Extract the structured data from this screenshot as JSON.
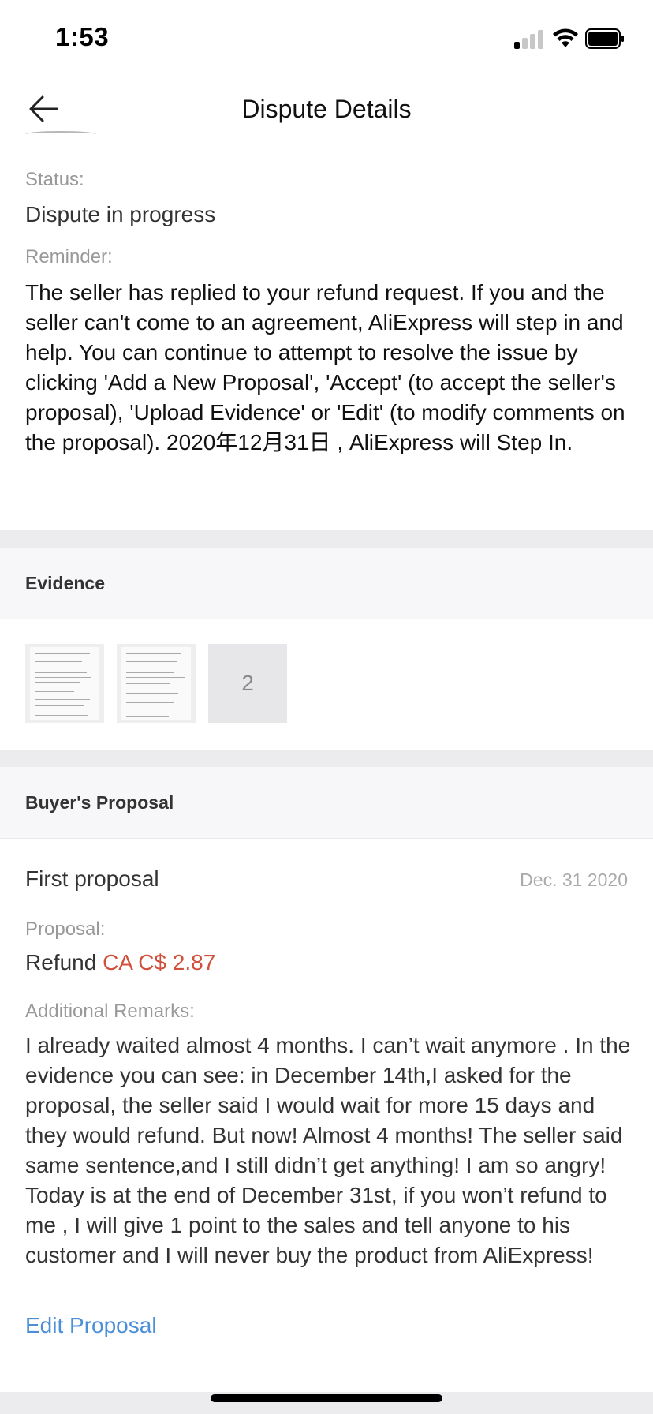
{
  "status_bar": {
    "time": "1:53"
  },
  "header": {
    "title": "Dispute Details",
    "back_icon": "arrow-left-icon"
  },
  "dispute": {
    "status_label": "Status:",
    "status_value": "Dispute in progress",
    "reminder_label": "Reminder:",
    "reminder_text": "The seller has replied to your refund request. If you and the seller can't come to an agreement, AliExpress will step in and help. You can continue to attempt to resolve the issue by clicking 'Add a New Proposal', 'Accept' (to accept the seller's proposal), 'Upload Evidence' or 'Edit' (to modify comments on the proposal). 2020年12月31日 , AliExpress will Step In."
  },
  "evidence": {
    "title": "Evidence",
    "more_count": "2"
  },
  "buyer_proposal": {
    "section_title": "Buyer's Proposal",
    "proposal_title": "First proposal",
    "date": "Dec. 31 2020",
    "proposal_label": "Proposal:",
    "refund_prefix": "Refund",
    "refund_amount": "CA C$ 2.87",
    "remarks_label": "Additional Remarks:",
    "remarks_text": "I already waited almost 4 months. I can’t wait anymore . In the evidence you can see: in December 14th,I asked for the proposal, the seller said I would wait for more 15 days and they would refund. But now! Almost 4 months! The seller said same sentence,and I still didn’t get anything! I am so angry!\nToday is at the end of December 31st, if you won’t refund to me , I will give 1 point to the sales and tell anyone to his customer and I will never buy the product from AliExpress!",
    "edit_label": "Edit Proposal"
  },
  "colors": {
    "accent_link": "#4a8fd8",
    "amount_red": "#d0503b"
  }
}
